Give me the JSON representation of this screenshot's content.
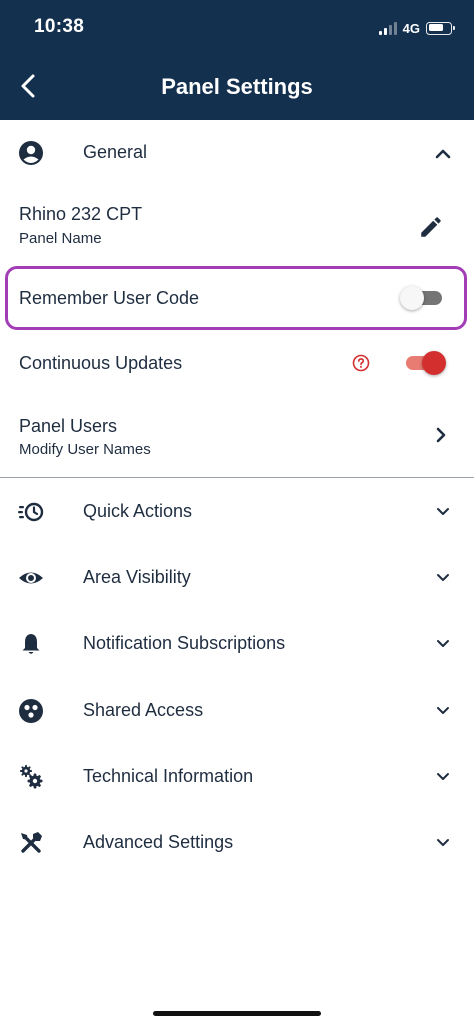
{
  "status_bar": {
    "time": "10:38",
    "network": "4G",
    "battery_level": 0.7
  },
  "header": {
    "title": "Panel Settings",
    "back_icon": "chevron-left-icon"
  },
  "general": {
    "label": "General",
    "icon": "account-circle-icon",
    "expanded": true,
    "panel_name": {
      "value": "Rhino 232 CPT",
      "caption": "Panel Name",
      "edit_icon": "pencil-icon"
    },
    "remember_user_code": {
      "label": "Remember User Code",
      "enabled": false
    },
    "continuous_updates": {
      "label": "Continuous Updates",
      "enabled": true,
      "help_icon": "help-circle-icon"
    },
    "panel_users": {
      "label": "Panel Users",
      "caption": "Modify User Names",
      "icon": "chevron-right-icon"
    }
  },
  "sections": [
    {
      "label": "Quick Actions",
      "icon": "quick-actions-icon"
    },
    {
      "label": "Area Visibility",
      "icon": "eye-icon"
    },
    {
      "label": "Notification Subscriptions",
      "icon": "bell-icon"
    },
    {
      "label": "Shared Access",
      "icon": "shared-access-icon"
    },
    {
      "label": "Technical Information",
      "icon": "gears-icon"
    },
    {
      "label": "Advanced Settings",
      "icon": "tools-icon"
    }
  ],
  "colors": {
    "header_bg": "#14304f",
    "text": "#1f2d40",
    "highlight_border": "#a23db6",
    "toggle_on": "#d32f2f",
    "help_icon": "#d32f2f"
  }
}
